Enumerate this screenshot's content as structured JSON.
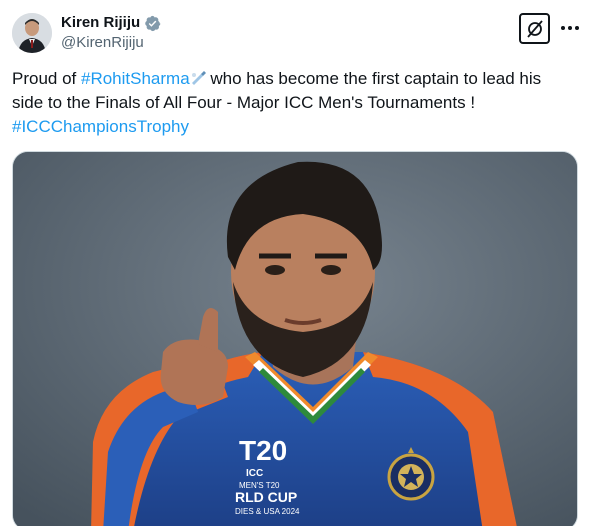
{
  "author": {
    "name": "Kiren Rijiju",
    "handle": "@KirenRijiju",
    "avatar_icon": "profile-photo",
    "verified_icon": "verified-badge-icon"
  },
  "header_actions": {
    "grok_icon": "grok-icon",
    "more_icon": "more-options-icon"
  },
  "tweet": {
    "line1_prefix": "Proud of ",
    "hashtag1": "#RohitSharma",
    "line1_suffix": " who has become the first captain to lead his",
    "line2": "side to the Finals of All Four - Major ICC Men's Tournaments !",
    "hashtag2": "#ICCChampionsTrophy"
  },
  "media": {
    "description_icon": "photo-cricketer-pointing",
    "logo_text_1": "T20",
    "logo_text_2": "ICC",
    "logo_text_3": "MEN'S T20",
    "logo_text_4": "RLD CUP",
    "logo_text_5": "DIES & USA 2024"
  },
  "colors": {
    "hashtag": "#1d9bf0",
    "text": "#0f1419",
    "secondary": "#536471",
    "verified": "#829aab"
  }
}
